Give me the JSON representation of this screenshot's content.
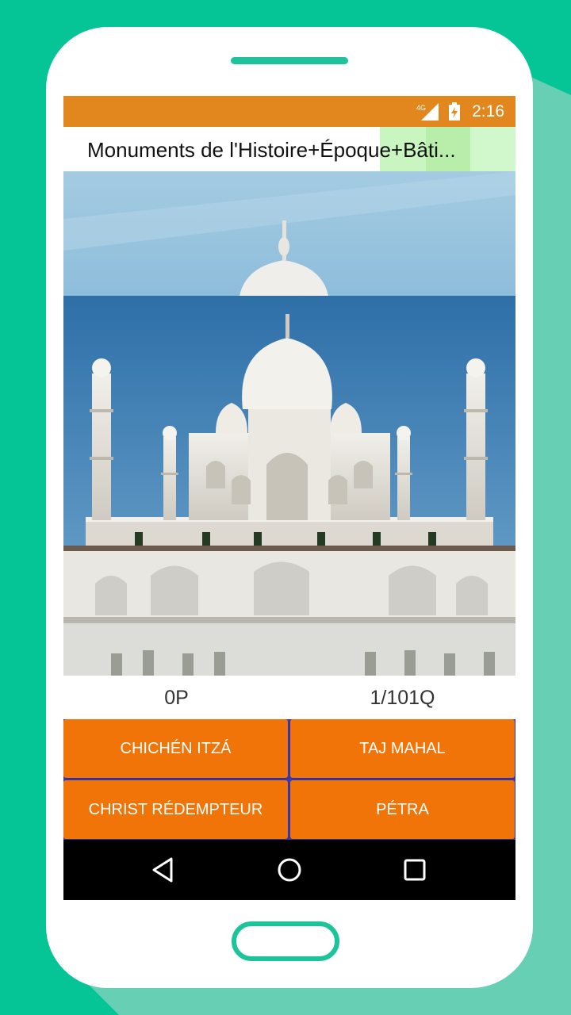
{
  "status_bar": {
    "time": "2:16",
    "network": "4G"
  },
  "app": {
    "title": "Monuments de l'Histoire+Époque+Bâti..."
  },
  "quiz": {
    "score": "0P",
    "progress": "1/101Q",
    "answers": [
      "CHICHÉN ITZÁ",
      "TAJ MAHAL",
      "CHRIST RÉDEMPTEUR",
      "PÉTRA"
    ]
  },
  "nav": {
    "icons": [
      "back-icon",
      "home-icon",
      "recents-icon"
    ]
  },
  "colors": {
    "background": "#05c597",
    "status_bar": "#e1871d",
    "answer_button": "#f07408",
    "title_highlight": "#c9f5c0"
  }
}
